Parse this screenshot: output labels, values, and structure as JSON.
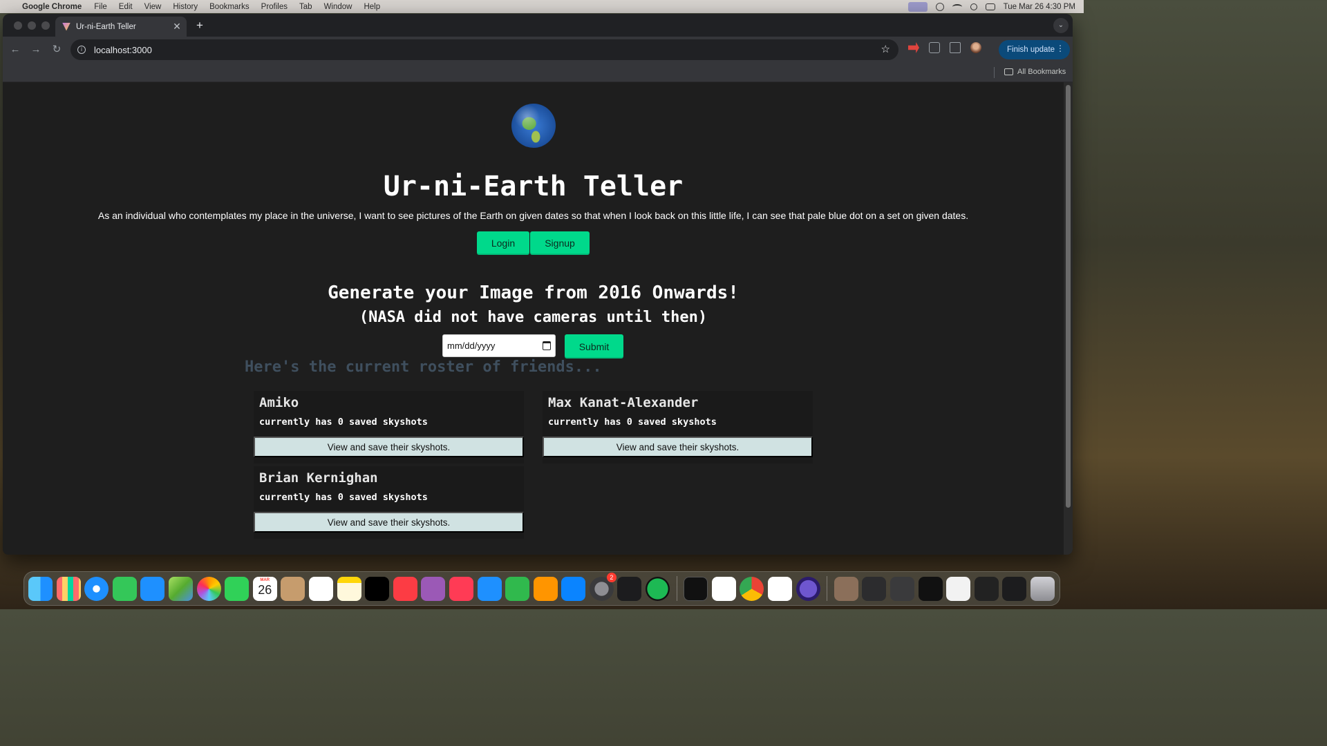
{
  "menubar": {
    "app_name": "Google Chrome",
    "items": [
      "File",
      "Edit",
      "View",
      "History",
      "Bookmarks",
      "Profiles",
      "Tab",
      "Window",
      "Help"
    ],
    "clock": "Tue Mar 26  4:30 PM"
  },
  "browser": {
    "tab_title": "Ur-ni-Earth Teller",
    "url": "localhost:3000",
    "finish_update_label": "Finish update",
    "all_bookmarks_label": "All Bookmarks"
  },
  "page": {
    "title": "Ur-ni-Earth Teller",
    "tagline": "As an individual who contemplates my place in the universe, I want to see pictures of the Earth on given dates so that when I look back on this little life, I can see that pale blue dot on a set on given dates.",
    "login_label": "Login",
    "signup_label": "Signup",
    "generate_heading": "Generate your Image from 2016 Onwards!",
    "nasa_note": "(NASA did not have cameras until then)",
    "date_placeholder": "mm/dd/yyyy",
    "submit_label": "Submit",
    "roster_heading": "Here's the current roster of friends...",
    "friends": [
      {
        "name": "Amiko",
        "count_text": "currently has 0 saved skyshots",
        "button_label": "View and save their skyshots."
      },
      {
        "name": "Max Kanat-Alexander",
        "count_text": "currently has 0 saved skyshots",
        "button_label": "View and save their skyshots."
      },
      {
        "name": "Brian Kernighan",
        "count_text": "currently has 0 saved skyshots",
        "button_label": "View and save their skyshots."
      }
    ]
  },
  "dock": {
    "calendar_month": "MAR",
    "calendar_day": "26",
    "settings_badge": "2"
  },
  "colors": {
    "accent_green": "#00d98b",
    "page_background": "#1e1e1e",
    "card_button": "#d0e2e2",
    "roster_heading": "#3f4f5e"
  }
}
